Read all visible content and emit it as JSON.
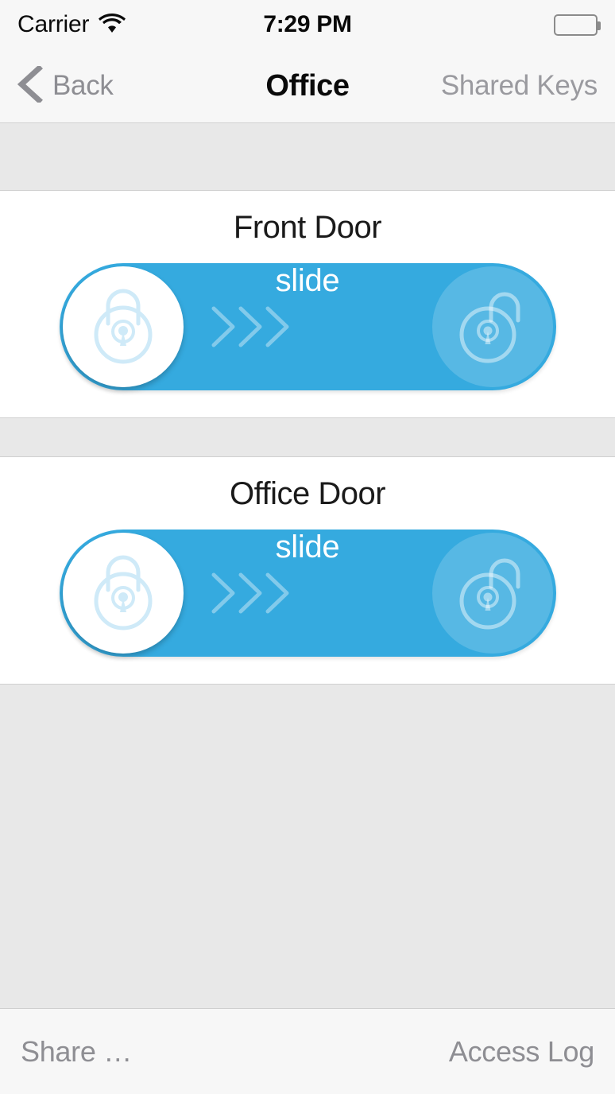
{
  "status_bar": {
    "carrier": "Carrier",
    "wifi_icon": "wifi-icon",
    "time": "7:29 PM",
    "battery_icon": "battery-full-icon"
  },
  "nav_bar": {
    "back_icon": "chevron-left-icon",
    "back_label": "Back",
    "title": "Office",
    "right_action": "Shared Keys"
  },
  "doors": [
    {
      "name": "Front Door",
      "slider": {
        "label": "slide",
        "knob_icon": "lock-closed-icon",
        "target_icon": "lock-open-icon",
        "arrows_icon": "chevron-right-triple-icon",
        "state": "locked"
      }
    },
    {
      "name": "Office Door",
      "slider": {
        "label": "slide",
        "knob_icon": "lock-closed-icon",
        "target_icon": "lock-open-icon",
        "arrows_icon": "chevron-right-triple-icon",
        "state": "locked"
      }
    }
  ],
  "toolbar": {
    "share_label": "Share …",
    "access_log_label": "Access Log"
  },
  "colors": {
    "accent_blue": "#35aadf",
    "background_gray": "#e8e8e8",
    "bar_gray": "#f7f7f7",
    "muted_text": "#8e8e93",
    "white": "#ffffff"
  }
}
